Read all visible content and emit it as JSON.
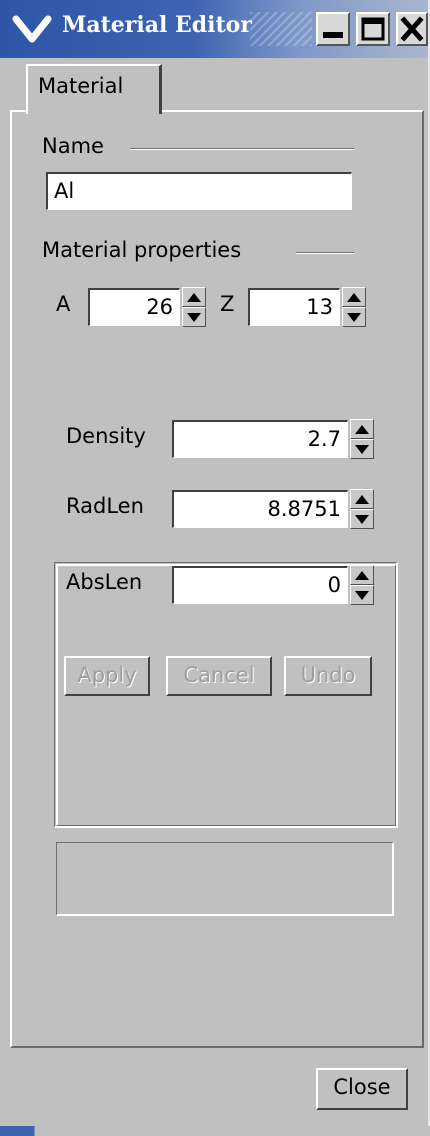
{
  "window": {
    "title": "Material Editor",
    "icons": {
      "menu": "chevron-down-icon",
      "minimize": "minimize-icon",
      "maximize": "maximize-icon",
      "close": "close-x-icon"
    },
    "titlebar_color": "#3d64b2"
  },
  "tabs": [
    {
      "label": "Material",
      "selected": true
    }
  ],
  "name_section": {
    "label": "Name",
    "value": "Al"
  },
  "properties": {
    "label": "Material properties",
    "a": {
      "label": "A",
      "value": "26"
    },
    "z": {
      "label": "Z",
      "value": "13"
    },
    "density": {
      "label": "Density",
      "value": "2.7"
    },
    "radlen": {
      "label": "RadLen",
      "value": "8.8751"
    },
    "abslen": {
      "label": "AbsLen",
      "value": "0"
    }
  },
  "actions": {
    "apply": {
      "label": "Apply",
      "enabled": false
    },
    "cancel": {
      "label": "Cancel",
      "enabled": false
    },
    "undo": {
      "label": "Undo",
      "enabled": false
    }
  },
  "footer": {
    "close_label": "Close"
  }
}
